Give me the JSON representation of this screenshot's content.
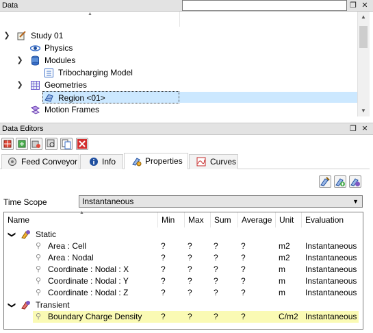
{
  "data_panel": {
    "title": "Data",
    "search": {
      "value": "",
      "placeholder": ""
    },
    "tree": [
      {
        "label": "Study 01",
        "icon": "study-icon",
        "expanded": true
      },
      {
        "label": "Physics",
        "icon": "physics-icon"
      },
      {
        "label": "Modules",
        "icon": "modules-icon",
        "expanded": true
      },
      {
        "label": "Tribocharging Model",
        "icon": "model-icon"
      },
      {
        "label": "Geometries",
        "icon": "geometries-icon",
        "expanded": true
      },
      {
        "label": "Region <01>",
        "icon": "region-icon",
        "selected": true
      },
      {
        "label": "Motion Frames",
        "icon": "motion-frames-icon"
      }
    ]
  },
  "editors_panel": {
    "title": "Data Editors",
    "toolbar_icons": [
      "mesh-icon",
      "refresh-icon",
      "link-icon",
      "inspect-icon",
      "copy-icon",
      "delete-icon"
    ],
    "tabs": [
      {
        "label": "Feed Conveyor",
        "icon": "conveyor-icon"
      },
      {
        "label": "Info",
        "icon": "info-icon"
      },
      {
        "label": "Properties",
        "icon": "properties-icon",
        "active": true
      },
      {
        "label": "Curves",
        "icon": "curves-icon"
      }
    ],
    "action_icons": [
      "edit-properties-icon",
      "add-property-icon",
      "remove-property-icon"
    ],
    "time_scope": {
      "label": "Time Scope",
      "value": "Instantaneous"
    },
    "grid": {
      "columns": [
        "Name",
        "Min",
        "Max",
        "Sum",
        "Average",
        "Unit",
        "Evaluation"
      ],
      "groups": [
        {
          "name": "Static",
          "rows": [
            {
              "name": "Area : Cell",
              "min": "?",
              "max": "?",
              "sum": "?",
              "average": "?",
              "unit": "m2",
              "evaluation": "Instantaneous"
            },
            {
              "name": "Area : Nodal",
              "min": "?",
              "max": "?",
              "sum": "?",
              "average": "?",
              "unit": "m2",
              "evaluation": "Instantaneous"
            },
            {
              "name": "Coordinate : Nodal : X",
              "min": "?",
              "max": "?",
              "sum": "?",
              "average": "?",
              "unit": "m",
              "evaluation": "Instantaneous"
            },
            {
              "name": "Coordinate : Nodal : Y",
              "min": "?",
              "max": "?",
              "sum": "?",
              "average": "?",
              "unit": "m",
              "evaluation": "Instantaneous"
            },
            {
              "name": "Coordinate : Nodal : Z",
              "min": "?",
              "max": "?",
              "sum": "?",
              "average": "?",
              "unit": "m",
              "evaluation": "Instantaneous"
            }
          ]
        },
        {
          "name": "Transient",
          "rows": [
            {
              "name": "Boundary Charge Density",
              "min": "?",
              "max": "?",
              "sum": "?",
              "average": "?",
              "unit": "C/m2",
              "evaluation": "Instantaneous",
              "highlighted": true
            }
          ]
        }
      ]
    }
  },
  "colors": {
    "selection": "#cce8ff",
    "highlight": "#fafab4",
    "header_bg": "#e3e3e3"
  }
}
